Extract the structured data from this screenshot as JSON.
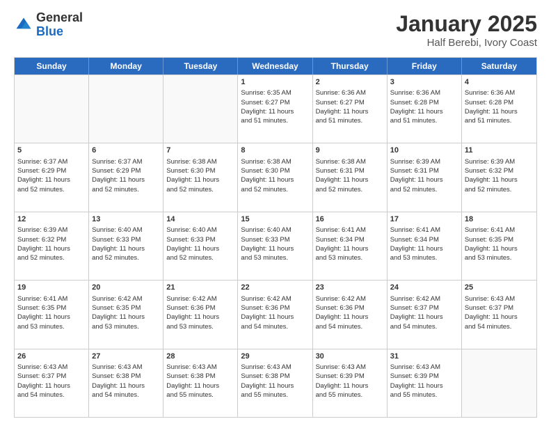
{
  "logo": {
    "general": "General",
    "blue": "Blue"
  },
  "title": {
    "month": "January 2025",
    "location": "Half Berebi, Ivory Coast"
  },
  "calendar": {
    "headers": [
      "Sunday",
      "Monday",
      "Tuesday",
      "Wednesday",
      "Thursday",
      "Friday",
      "Saturday"
    ],
    "rows": [
      [
        {
          "day": "",
          "info": ""
        },
        {
          "day": "",
          "info": ""
        },
        {
          "day": "",
          "info": ""
        },
        {
          "day": "1",
          "info": "Sunrise: 6:35 AM\nSunset: 6:27 PM\nDaylight: 11 hours\nand 51 minutes."
        },
        {
          "day": "2",
          "info": "Sunrise: 6:36 AM\nSunset: 6:27 PM\nDaylight: 11 hours\nand 51 minutes."
        },
        {
          "day": "3",
          "info": "Sunrise: 6:36 AM\nSunset: 6:28 PM\nDaylight: 11 hours\nand 51 minutes."
        },
        {
          "day": "4",
          "info": "Sunrise: 6:36 AM\nSunset: 6:28 PM\nDaylight: 11 hours\nand 51 minutes."
        }
      ],
      [
        {
          "day": "5",
          "info": "Sunrise: 6:37 AM\nSunset: 6:29 PM\nDaylight: 11 hours\nand 52 minutes."
        },
        {
          "day": "6",
          "info": "Sunrise: 6:37 AM\nSunset: 6:29 PM\nDaylight: 11 hours\nand 52 minutes."
        },
        {
          "day": "7",
          "info": "Sunrise: 6:38 AM\nSunset: 6:30 PM\nDaylight: 11 hours\nand 52 minutes."
        },
        {
          "day": "8",
          "info": "Sunrise: 6:38 AM\nSunset: 6:30 PM\nDaylight: 11 hours\nand 52 minutes."
        },
        {
          "day": "9",
          "info": "Sunrise: 6:38 AM\nSunset: 6:31 PM\nDaylight: 11 hours\nand 52 minutes."
        },
        {
          "day": "10",
          "info": "Sunrise: 6:39 AM\nSunset: 6:31 PM\nDaylight: 11 hours\nand 52 minutes."
        },
        {
          "day": "11",
          "info": "Sunrise: 6:39 AM\nSunset: 6:32 PM\nDaylight: 11 hours\nand 52 minutes."
        }
      ],
      [
        {
          "day": "12",
          "info": "Sunrise: 6:39 AM\nSunset: 6:32 PM\nDaylight: 11 hours\nand 52 minutes."
        },
        {
          "day": "13",
          "info": "Sunrise: 6:40 AM\nSunset: 6:33 PM\nDaylight: 11 hours\nand 52 minutes."
        },
        {
          "day": "14",
          "info": "Sunrise: 6:40 AM\nSunset: 6:33 PM\nDaylight: 11 hours\nand 52 minutes."
        },
        {
          "day": "15",
          "info": "Sunrise: 6:40 AM\nSunset: 6:33 PM\nDaylight: 11 hours\nand 53 minutes."
        },
        {
          "day": "16",
          "info": "Sunrise: 6:41 AM\nSunset: 6:34 PM\nDaylight: 11 hours\nand 53 minutes."
        },
        {
          "day": "17",
          "info": "Sunrise: 6:41 AM\nSunset: 6:34 PM\nDaylight: 11 hours\nand 53 minutes."
        },
        {
          "day": "18",
          "info": "Sunrise: 6:41 AM\nSunset: 6:35 PM\nDaylight: 11 hours\nand 53 minutes."
        }
      ],
      [
        {
          "day": "19",
          "info": "Sunrise: 6:41 AM\nSunset: 6:35 PM\nDaylight: 11 hours\nand 53 minutes."
        },
        {
          "day": "20",
          "info": "Sunrise: 6:42 AM\nSunset: 6:35 PM\nDaylight: 11 hours\nand 53 minutes."
        },
        {
          "day": "21",
          "info": "Sunrise: 6:42 AM\nSunset: 6:36 PM\nDaylight: 11 hours\nand 53 minutes."
        },
        {
          "day": "22",
          "info": "Sunrise: 6:42 AM\nSunset: 6:36 PM\nDaylight: 11 hours\nand 54 minutes."
        },
        {
          "day": "23",
          "info": "Sunrise: 6:42 AM\nSunset: 6:36 PM\nDaylight: 11 hours\nand 54 minutes."
        },
        {
          "day": "24",
          "info": "Sunrise: 6:42 AM\nSunset: 6:37 PM\nDaylight: 11 hours\nand 54 minutes."
        },
        {
          "day": "25",
          "info": "Sunrise: 6:43 AM\nSunset: 6:37 PM\nDaylight: 11 hours\nand 54 minutes."
        }
      ],
      [
        {
          "day": "26",
          "info": "Sunrise: 6:43 AM\nSunset: 6:37 PM\nDaylight: 11 hours\nand 54 minutes."
        },
        {
          "day": "27",
          "info": "Sunrise: 6:43 AM\nSunset: 6:38 PM\nDaylight: 11 hours\nand 54 minutes."
        },
        {
          "day": "28",
          "info": "Sunrise: 6:43 AM\nSunset: 6:38 PM\nDaylight: 11 hours\nand 55 minutes."
        },
        {
          "day": "29",
          "info": "Sunrise: 6:43 AM\nSunset: 6:38 PM\nDaylight: 11 hours\nand 55 minutes."
        },
        {
          "day": "30",
          "info": "Sunrise: 6:43 AM\nSunset: 6:39 PM\nDaylight: 11 hours\nand 55 minutes."
        },
        {
          "day": "31",
          "info": "Sunrise: 6:43 AM\nSunset: 6:39 PM\nDaylight: 11 hours\nand 55 minutes."
        },
        {
          "day": "",
          "info": ""
        }
      ]
    ]
  }
}
